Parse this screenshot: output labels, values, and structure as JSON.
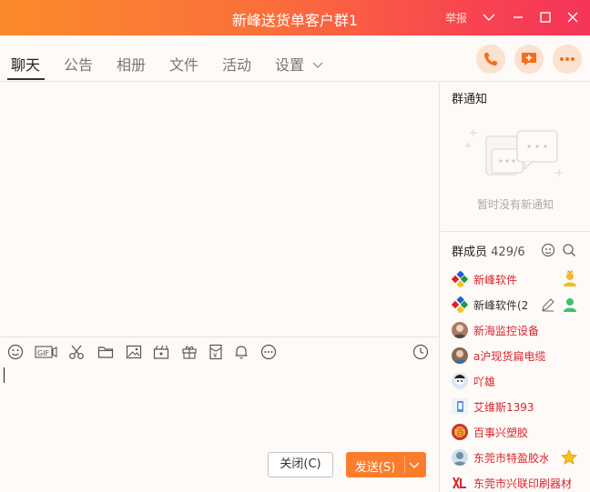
{
  "window": {
    "title": "新峰送货单客户群1",
    "report_label": "举报"
  },
  "tabs": [
    {
      "label": "聊天",
      "active": true
    },
    {
      "label": "公告"
    },
    {
      "label": "相册"
    },
    {
      "label": "文件"
    },
    {
      "label": "活动"
    },
    {
      "label": "设置"
    }
  ],
  "actions": [
    "phone-icon",
    "add-chat-icon",
    "more-icon"
  ],
  "toolbar_icons": [
    "emoji-icon",
    "gif-icon",
    "scissors-icon",
    "folder-icon",
    "image-icon",
    "video-icon",
    "gift-icon",
    "red-packet-icon",
    "bell-icon",
    "more-circle-icon",
    "history-icon"
  ],
  "buttons": {
    "close": "关闭(C)",
    "send": "发送(S)"
  },
  "notice": {
    "title": "群通知",
    "empty_text": "暂时没有新通知"
  },
  "members": {
    "title": "群成员",
    "count": "429/6",
    "list": [
      {
        "name": "新峰软件",
        "badge": "owner"
      },
      {
        "name": "新峰软件(2",
        "badge": "admin"
      },
      {
        "name": "新海监控设备"
      },
      {
        "name": "a沪现货扁电缆"
      },
      {
        "name": "吖雄"
      },
      {
        "name": "艾维斯1393"
      },
      {
        "name": "百事兴塑胶"
      },
      {
        "name": "东莞市特盈胶水",
        "badge": "star"
      },
      {
        "name": "东莞市兴联印刷器材"
      }
    ]
  },
  "colors": {
    "accent": "#fb7d2b",
    "title_gradient_start": "#fb8a2a",
    "title_gradient_end": "#f5345a",
    "member_name": "#d9262f"
  }
}
